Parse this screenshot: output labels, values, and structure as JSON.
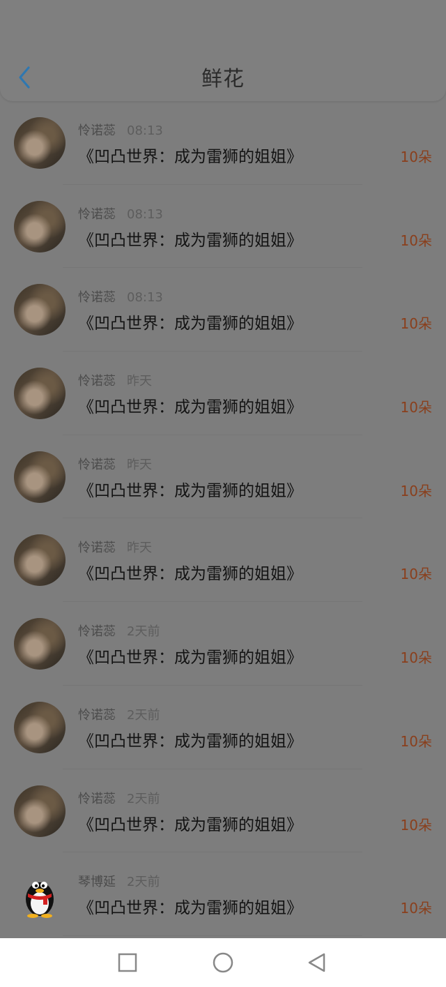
{
  "header": {
    "title": "鲜花"
  },
  "icons": {
    "back": "chevron-left-icon",
    "home": "circle-icon",
    "recent": "square-icon",
    "back_nav": "triangle-left-icon"
  },
  "colors": {
    "accent": "#2f77b0",
    "amount": "#8a3f1c"
  },
  "records": [
    {
      "name": "怜诺蕊",
      "time": "08:13",
      "book": "《凹凸世界：成为雷狮的姐姐》",
      "amount": "10朵",
      "avatar": "photo"
    },
    {
      "name": "怜诺蕊",
      "time": "08:13",
      "book": "《凹凸世界：成为雷狮的姐姐》",
      "amount": "10朵",
      "avatar": "photo"
    },
    {
      "name": "怜诺蕊",
      "time": "08:13",
      "book": "《凹凸世界：成为雷狮的姐姐》",
      "amount": "10朵",
      "avatar": "photo"
    },
    {
      "name": "怜诺蕊",
      "time": "昨天",
      "book": "《凹凸世界：成为雷狮的姐姐》",
      "amount": "10朵",
      "avatar": "photo"
    },
    {
      "name": "怜诺蕊",
      "time": "昨天",
      "book": "《凹凸世界：成为雷狮的姐姐》",
      "amount": "10朵",
      "avatar": "photo"
    },
    {
      "name": "怜诺蕊",
      "time": "昨天",
      "book": "《凹凸世界：成为雷狮的姐姐》",
      "amount": "10朵",
      "avatar": "photo"
    },
    {
      "name": "怜诺蕊",
      "time": "2天前",
      "book": "《凹凸世界：成为雷狮的姐姐》",
      "amount": "10朵",
      "avatar": "photo"
    },
    {
      "name": "怜诺蕊",
      "time": "2天前",
      "book": "《凹凸世界：成为雷狮的姐姐》",
      "amount": "10朵",
      "avatar": "photo"
    },
    {
      "name": "怜诺蕊",
      "time": "2天前",
      "book": "《凹凸世界：成为雷狮的姐姐》",
      "amount": "10朵",
      "avatar": "photo"
    },
    {
      "name": "琴博延",
      "time": "2天前",
      "book": "《凹凸世界：成为雷狮的姐姐》",
      "amount": "10朵",
      "avatar": "penguin"
    }
  ]
}
